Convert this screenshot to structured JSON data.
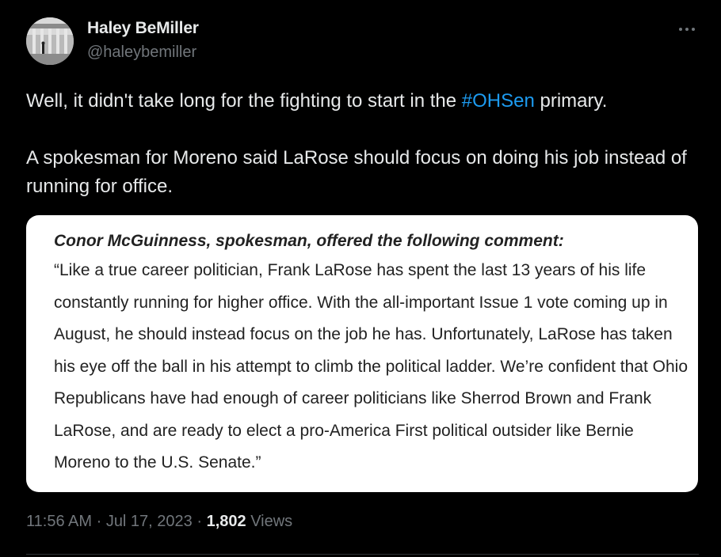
{
  "author": {
    "name": "Haley BeMiller",
    "handle": "@haleybemiller",
    "avatar_icon": "profile-photo"
  },
  "more_icon": "more-horizontal-icon",
  "tweet": {
    "line1_before": "Well, it didn't take long for the fighting to start in the ",
    "hashtag": "#OHSen",
    "line1_after": " primary.",
    "paragraph2": "A spokesman for Moreno said LaRose should focus on doing his job instead of running for office."
  },
  "media": {
    "heading": "Conor McGuinness, spokesman, offered the following comment:",
    "quote": "“Like a true career politician, Frank LaRose has spent the last 13 years of his life constantly running for higher office. With the all-important Issue 1 vote coming up in August, he should instead focus on the job he has. Unfortunately, LaRose has taken his eye off the ball in his attempt to climb the political ladder. We’re confident that Ohio Republicans have had enough of career politicians like Sherrod Brown and Frank LaRose, and are ready to elect a pro-America First political outsider like Bernie Moreno to the U.S. Senate.”"
  },
  "meta": {
    "time": "11:56 AM",
    "sep1": " · ",
    "date": "Jul 17, 2023",
    "sep2": " · ",
    "views_count": "1,802",
    "views_label": " Views"
  },
  "colors": {
    "background": "#000000",
    "text": "#e7e9ea",
    "muted": "#71767b",
    "link": "#1d9bf0"
  }
}
